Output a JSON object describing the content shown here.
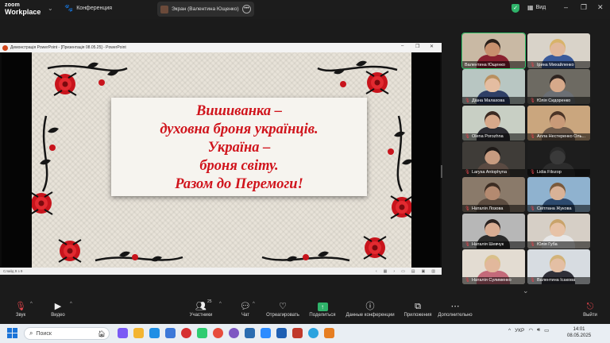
{
  "topbar": {
    "logo_line1": "zoom",
    "logo_line2": "Workplace",
    "meetings_label": "Конференция",
    "screen_share_label": "Экран (Валентина Ющенко)",
    "view_label": "Вид"
  },
  "shared_window": {
    "title": "Демонстрація PowerPoint - [Презентація 08.05.25] - PowerPoint",
    "status": "Слайд 9 з 9",
    "slide_lines": [
      "Вишиванка –",
      "духовна броня українців.",
      "Україна –",
      "броня світу.",
      "Разом до Перемоги!"
    ]
  },
  "participants": [
    {
      "name": "Валентина Ющенко",
      "muted": false,
      "bg": "#c9b9a4",
      "skin": "#c8906e",
      "hair": "#2a1f1a",
      "shirt": "#8a2130"
    },
    {
      "name": "Ірина Михайленко",
      "muted": true,
      "bg": "#d9d3c9",
      "skin": "#e1b89b",
      "hair": "#d8b36a",
      "shirt": "#3a5a9a"
    },
    {
      "name": "Діана Малахова",
      "muted": true,
      "bg": "#b8c6c2",
      "skin": "#e4bda1",
      "hair": "#b99060",
      "shirt": "#2f3f66"
    },
    {
      "name": "Юлія Сидоренко",
      "muted": true,
      "bg": "#6d6a62",
      "skin": "#d6a98a",
      "hair": "#2e2420",
      "shirt": "#6b6f74"
    },
    {
      "name": "Olena Porozhna",
      "muted": true,
      "bg": "#c8cfc4",
      "skin": "#d8a98a",
      "hair": "#3b2a22",
      "shirt": "#2d2d33"
    },
    {
      "name": "Алла Нестеренко Оль...",
      "muted": true,
      "bg": "#caa67e",
      "skin": "#c99a78",
      "hair": "#4b3426",
      "shirt": "#6e5a4a"
    },
    {
      "name": "Larysa Antophyna",
      "muted": true,
      "bg": "#3f3c38",
      "skin": "#c79b80",
      "hair": "#1f1a18",
      "shirt": "#5a4a42"
    },
    {
      "name": "Lidia Filozop",
      "muted": true,
      "bg": "#1d1d1d",
      "skin": "#3a3a3a",
      "hair": "#2a2a2a",
      "shirt": "#2c2c2c"
    },
    {
      "name": "Наталія Лозова",
      "muted": true,
      "bg": "#8a7a6a",
      "skin": "#b48a70",
      "hair": "#3c2c22",
      "shirt": "#5c4c40"
    },
    {
      "name": "Світлана Жукова",
      "muted": true,
      "bg": "#8fb2cf",
      "skin": "#d9b297",
      "hair": "#7a5a3c",
      "shirt": "#2d4a6e"
    },
    {
      "name": "Наталія Шевчук",
      "muted": true,
      "bg": "#b7b7b7",
      "skin": "#d9ad93",
      "hair": "#2b2220",
      "shirt": "#2b2b2b"
    },
    {
      "name": "Юлія Губа",
      "muted": true,
      "bg": "#d6cfc6",
      "skin": "#e7c2a6",
      "hair": "#c9a36a",
      "shirt": "#e7e7e7"
    },
    {
      "name": "Наталія Сулименко",
      "muted": true,
      "bg": "#e3dcd2",
      "skin": "#e2b89c",
      "hair": "#d9c08a",
      "shirt": "#c46a7a"
    },
    {
      "name": "Валентина Ісакова",
      "muted": true,
      "bg": "#d7dce1",
      "skin": "#e4bfa4",
      "hair": "#d2b37a",
      "shirt": "#2f2f38"
    }
  ],
  "toolbar": {
    "mute_label": "Звук",
    "video_label": "Видео",
    "participants_label": "Участники",
    "participants_count": "25",
    "chat_label": "Чат",
    "react_label": "Отреагировать",
    "share_label": "Поделиться",
    "info_label": "Данные конференции",
    "apps_label": "Приложения",
    "more_label": "Дополнительно",
    "leave_label": "Выйти"
  },
  "taskbar": {
    "search_placeholder": "Поиск",
    "lang": "УКР",
    "time": "14:01",
    "date": "08.05.2025"
  },
  "colors": {
    "accent_green": "#2fb36a",
    "slide_text": "#d0141c",
    "muted_red": "#e3444c"
  }
}
